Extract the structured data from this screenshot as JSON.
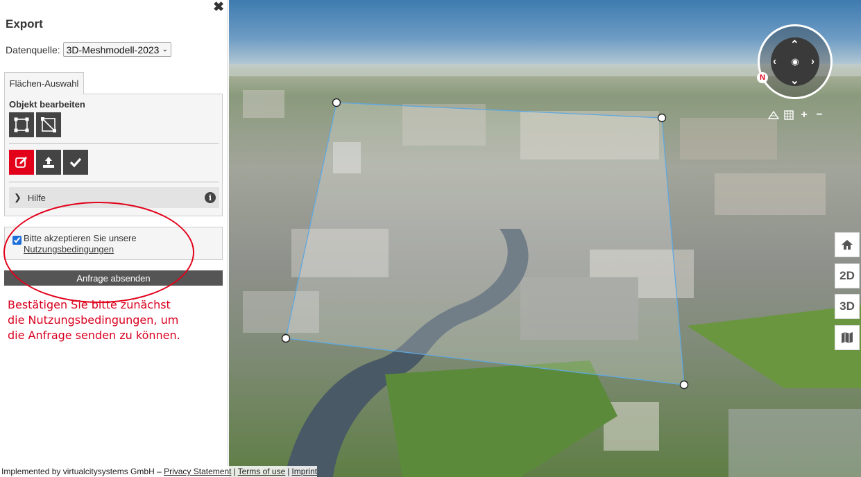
{
  "panel": {
    "close": "✖",
    "title": "Export",
    "source_label": "Datenquelle:",
    "source_value": "3D-Meshmodell-2023",
    "tab_label": "Flächen-Auswahl",
    "edit_title": "Objekt bearbeiten",
    "help_label": "Hilfe",
    "terms_text": "Bitte akzeptieren Sie unsere",
    "terms_link": "Nutzungsbedingungen",
    "terms_checked": true,
    "submit_label": "Anfrage absenden",
    "warning": "Bestätigen Sie bitte zunächst die Nutzungsbedingungen, um die Anfrage senden zu können."
  },
  "icons": {
    "close": "close-icon",
    "select_polygon": "polygon-select-icon",
    "select_box": "box-select-icon",
    "draw": "edit-icon",
    "upload": "upload-icon",
    "confirm": "check-icon",
    "help_expand": "chevron-right-icon",
    "info": "info-icon"
  },
  "map": {
    "north_label": "N",
    "side_buttons": [
      "2D",
      "3D"
    ]
  },
  "footer": {
    "credit": "Implemented by virtualcitysystems GmbH –",
    "privacy": "Privacy Statement",
    "terms": "Terms of use",
    "imprint": "Imprint"
  },
  "colors": {
    "accent_red": "#e2001a",
    "button_dark": "#444444",
    "warning_red": "#d8001e"
  }
}
